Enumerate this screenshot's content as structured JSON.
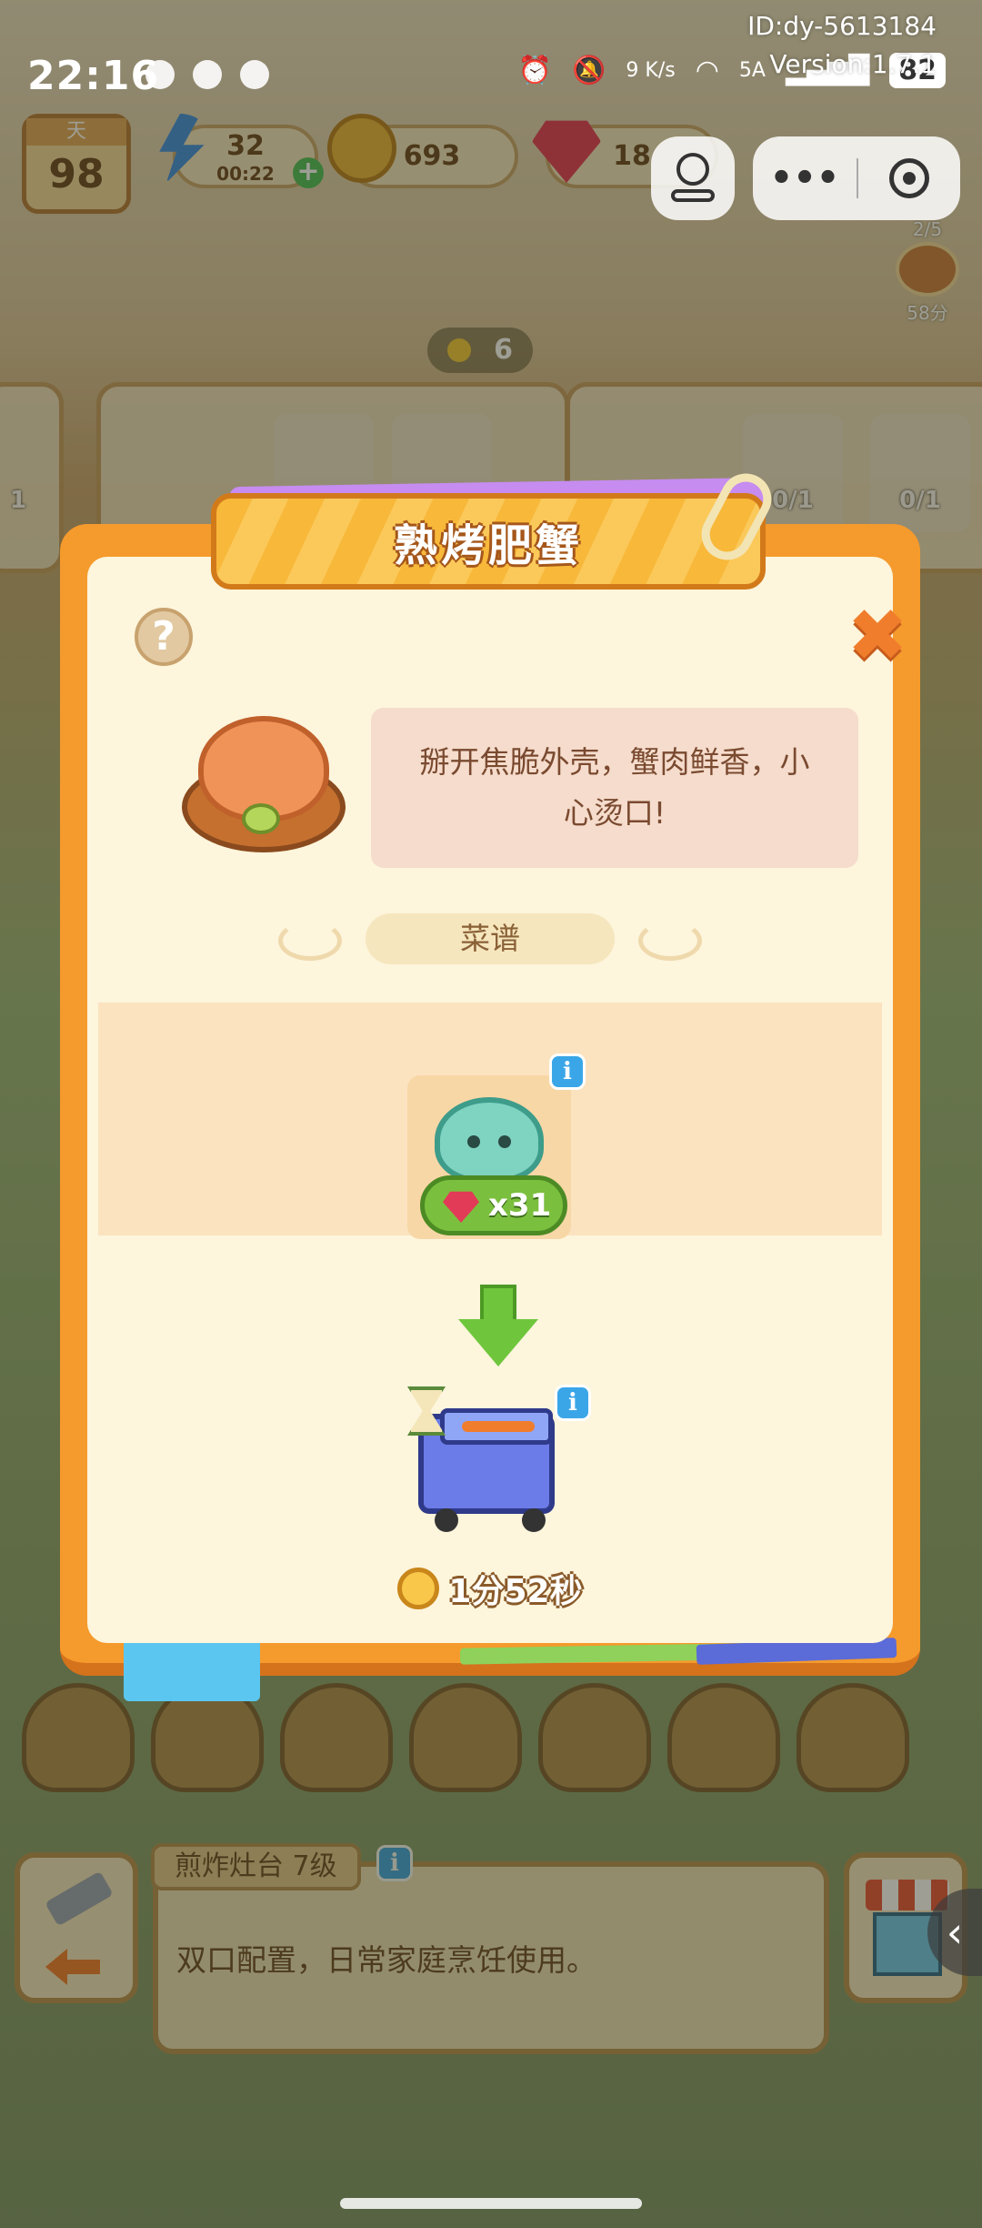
{
  "status_bar": {
    "time": "22:16",
    "network_speed": "9 K/s",
    "network_type": "5A",
    "battery": "82"
  },
  "overlay": {
    "id_label": "ID:dy-5613184",
    "version_label": "Version:1.7.1"
  },
  "hud": {
    "day_label": "天",
    "day_value": "98",
    "energy_value": "32",
    "energy_timer": "00:22",
    "coins": "693",
    "gems": "18"
  },
  "side_progress": {
    "count": "2/5",
    "points": "58分"
  },
  "scene": {
    "duck_count": "6",
    "order_left_count": "1",
    "order_right_counts": [
      "0/1",
      "0/1"
    ]
  },
  "modal": {
    "title": "熟烤肥蟹",
    "help_symbol": "?",
    "close_symbol": "✖",
    "description": "掰开焦脆外壳，蟹肉鲜香，小心烫口!",
    "recipe_label": "菜谱",
    "ingredient": {
      "icon": "crab-icon",
      "quantity_label": "x31"
    },
    "appliance": {
      "icon": "grill-machine-icon"
    },
    "cook_time": "1分52秒"
  },
  "tools": {
    "appliance_name": "煎炸灶台 7级",
    "appliance_description": "双口配置，日常家庭烹饪使用。"
  },
  "colors": {
    "modal_orange": "#f59a2c",
    "modal_cream": "#fdf5dc",
    "title_text": "#ffffff",
    "desc_bg": "#f5dccc",
    "qty_green": "#7bbf3e",
    "info_blue": "#3aa6e8"
  }
}
